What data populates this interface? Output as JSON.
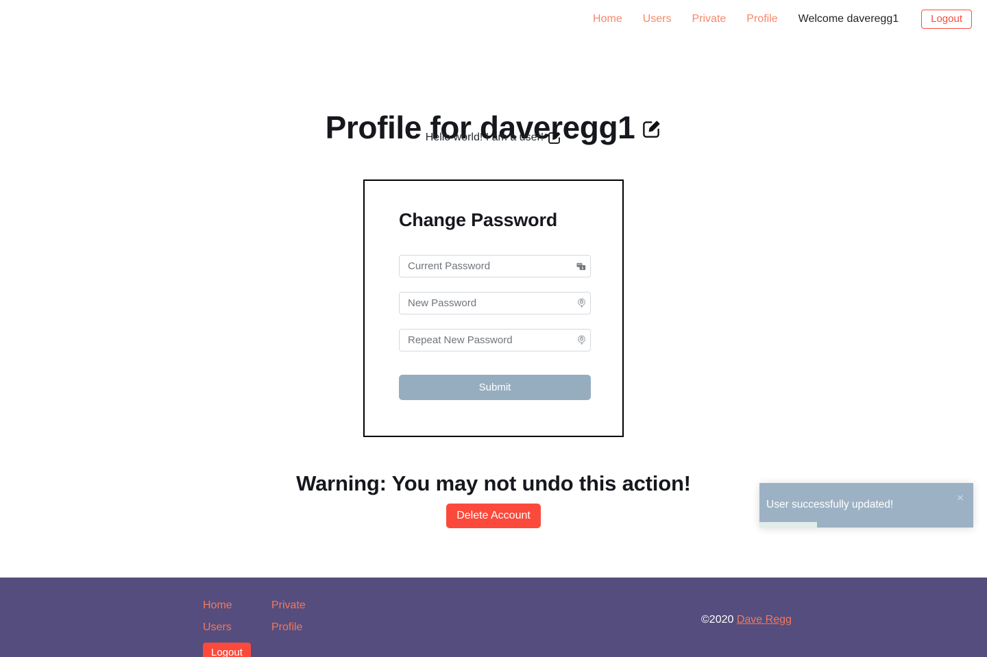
{
  "header": {
    "nav_links": [
      {
        "label": "Home",
        "name": "nav-link-home"
      },
      {
        "label": "Users",
        "name": "nav-link-users"
      },
      {
        "label": "Private",
        "name": "nav-link-private"
      },
      {
        "label": "Profile",
        "name": "nav-link-profile"
      }
    ],
    "welcome": "Welcome daveregg1",
    "logout_label": "Logout"
  },
  "main": {
    "title": "Profile for daveregg1",
    "title_edit_icon": "edit-pencil-icon",
    "subtitle": "Hello world! I am a user!",
    "subtitle_edit_icon": "edit-pencil-icon"
  },
  "change_password_card": {
    "title": "Change Password",
    "fields": [
      {
        "name": "current-password-input",
        "placeholder": "Current Password",
        "value": "",
        "icon": "saved-password-autofill-icon"
      },
      {
        "name": "new-password-input",
        "placeholder": "New Password",
        "value": "",
        "icon": "key-suggest-password-icon"
      },
      {
        "name": "repeat-new-password-input",
        "placeholder": "Repeat New Password",
        "value": "",
        "icon": "key-suggest-password-icon"
      }
    ],
    "submit_label": "Submit"
  },
  "danger_zone": {
    "warning": "Warning: You may not undo this action!",
    "delete_label": "Delete Account"
  },
  "toast": {
    "message": "User successfully updated!",
    "close_icon": "close-icon",
    "close_label": "×",
    "progress_percent": 27,
    "background_color": "#9cb2c4",
    "progress_color": "#e3ede9"
  },
  "footer": {
    "column_1": [
      {
        "label": "Home",
        "name": "footer-link-home"
      },
      {
        "label": "Users",
        "name": "footer-link-users"
      }
    ],
    "column_2": [
      {
        "label": "Private",
        "name": "footer-link-private"
      },
      {
        "label": "Profile",
        "name": "footer-link-profile"
      }
    ],
    "logout_label": "Logout",
    "copyright": "©2020",
    "author": "Dave Regg",
    "background_color": "#554d7d"
  },
  "colors": {
    "accent_orange": "#f4886a",
    "danger_red": "#fb4a3b",
    "submit_slate": "#96adc0",
    "footer_purple": "#554d7d"
  }
}
